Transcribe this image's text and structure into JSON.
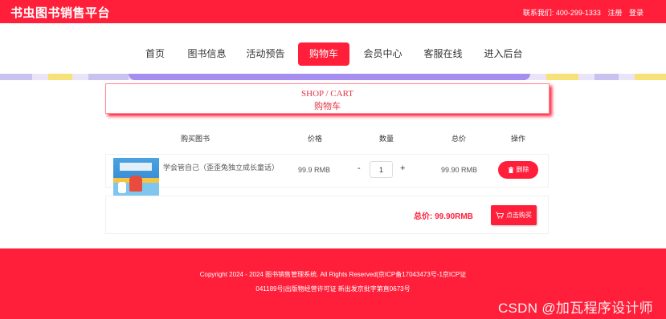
{
  "header": {
    "site_title": "书虫图书销售平台",
    "contact": "联系我们: 400-299-1333",
    "register": "注册",
    "login": "登录"
  },
  "nav": {
    "items": [
      {
        "label": "首页"
      },
      {
        "label": "图书信息"
      },
      {
        "label": "活动预告"
      },
      {
        "label": "购物车",
        "active": true
      },
      {
        "label": "会员中心"
      },
      {
        "label": "客服在线"
      },
      {
        "label": "进入后台"
      }
    ]
  },
  "cart": {
    "title_en": "SHOP / CART",
    "title_zh": "购物车",
    "columns": [
      "购买图书",
      "价格",
      "数量",
      "总价",
      "操作"
    ],
    "items": [
      {
        "name": "学会管自己（歪歪兔独立成长童话）",
        "price": "99.9 RMB",
        "quantity": "1",
        "total": "99.90 RMB",
        "delete_label": "删除",
        "minus": "-",
        "plus": "+"
      }
    ],
    "sum_label": "总价: 99.90RMB",
    "buy_label": "点击购买"
  },
  "footer": {
    "line1": "Copyright 2024 - 2024 图书销售管理系统. All Rights Reserved|京ICP备17043473号-1京ICP证",
    "line2": "041189号|出版物经营许可证 新出发京批字第直0673号"
  },
  "watermark": "CSDN @加瓦程序设计师",
  "colors": {
    "primary": "#ff1f3a",
    "text": "#333333"
  }
}
